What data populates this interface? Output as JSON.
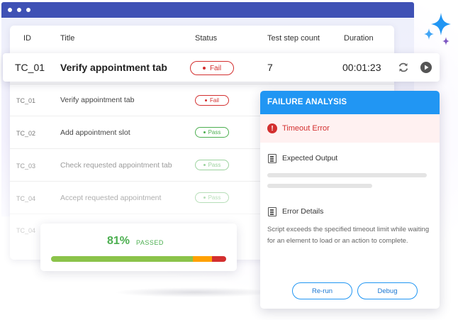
{
  "table": {
    "headers": {
      "id": "ID",
      "title": "Title",
      "status": "Status",
      "steps": "Test step count",
      "duration": "Duration"
    },
    "highlighted_row": {
      "id": "TC_01",
      "title": "Verify appointment tab",
      "status": "Fail",
      "steps": "7",
      "duration": "00:01:23"
    },
    "rows": [
      {
        "id": "TC_01",
        "title": "Verify appointment tab",
        "status": "Fail"
      },
      {
        "id": "TC_02",
        "title": "Add appointment slot",
        "status": "Pass"
      },
      {
        "id": "TC_03",
        "title": "Check requested appointment tab",
        "status": "Pass"
      },
      {
        "id": "TC_04",
        "title": "Accept requested appointment",
        "status": "Pass"
      },
      {
        "id": "TC_04",
        "title": "",
        "status": ""
      }
    ]
  },
  "summary": {
    "percent": "81%",
    "label": "PASSED",
    "bar": [
      {
        "name": "pass",
        "fraction": 0.81,
        "color": "#8bc34a"
      },
      {
        "name": "warn",
        "fraction": 0.11,
        "color": "#ffa000"
      },
      {
        "name": "fail",
        "fraction": 0.08,
        "color": "#d32f2f"
      }
    ]
  },
  "panel": {
    "title": "FAILURE ANALYSIS",
    "error": "Timeout Error",
    "expected_title": "Expected Output",
    "details_title": "Error Details",
    "details_text": "Script exceeds the specified timeout limit while waiting for an element to load or an action to complete.",
    "rerun_label": "Re-run",
    "debug_label": "Debug"
  },
  "colors": {
    "browser_bar": "#3f51b5",
    "panel_header": "#2196f3",
    "fail": "#d32f2f",
    "pass": "#4caf50"
  },
  "icons": [
    "refresh-icon",
    "play-icon",
    "error-icon",
    "document-icon",
    "sparkle-icon"
  ]
}
